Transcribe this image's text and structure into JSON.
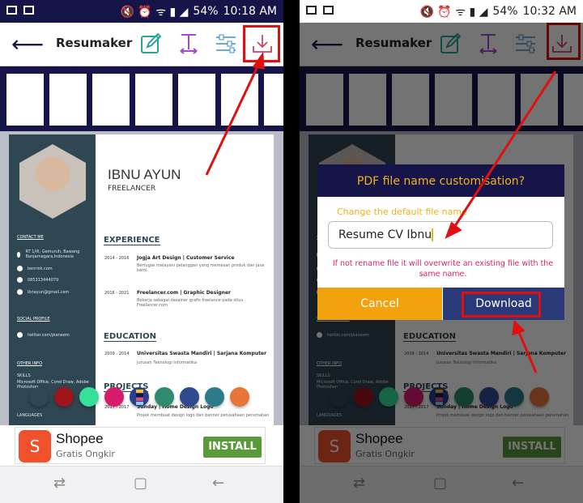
{
  "app": {
    "title": "Resumaker",
    "thumb_count": 7
  },
  "phones": [
    {
      "status": {
        "battery": "54%",
        "time": "10:18 AM"
      }
    },
    {
      "status": {
        "battery": "54%",
        "time": "10:32 AM"
      }
    }
  ],
  "toolbar": {
    "icons": [
      "back-arrow-icon",
      "edit-icon",
      "text-resize-icon",
      "sliders-icon",
      "download-icon"
    ]
  },
  "resume": {
    "name": "IBNU AYUN",
    "role": "FREELANCER",
    "contact_heading": "CONTACT ME",
    "contacts": [
      "RT 1/III, Gemuruh, Bawang Banjarnegara,Indonesia",
      "benrisk.com",
      "085313444079",
      "ibnayun@gmail.com"
    ],
    "social_heading": "SOCIAL PROFILE",
    "social": "twitter.com/pianeem",
    "other_heading": "OTHER INFO",
    "skills_label": "SKILLS",
    "skills": "Microsoft Office, Corel Draw, Adobe Photoshop",
    "languages_label": "LANGUAGES",
    "experience_heading": "EXPERIENCE",
    "experience": [
      {
        "years": "2014 - 2016",
        "title": "Jogja Art Design | Customer Service",
        "desc": "Bertugas melayani pelanggan yang memesan produk dan jasa kami."
      },
      {
        "years": "2016 - 2021",
        "title": "Freelancer.com | Graphic Designer",
        "desc": "Bekerja sebagai desainer grafis freelance pada situs Freelancer.com"
      }
    ],
    "education_heading": "EDUCATION",
    "education": [
      {
        "years": "2009 - 2014",
        "title": "Universitas Swasta Mandiri | Sarjana Komputer",
        "desc": "Jurusan Teknologi Informatika"
      }
    ],
    "projects_heading": "PROJECTS",
    "projects": [
      {
        "years": "2017 - 2017",
        "title": "Sunday | Home Design Logo",
        "desc": "Projek membuat design logo dan banner perusahaan perumahan"
      }
    ]
  },
  "swatches": [
    "#2f4653",
    "#a0141b",
    "#35e09a",
    "#d81b6a",
    "palette",
    "#2e8b6e",
    "#2f4b8f",
    "#2c7a8c",
    "#e8743a"
  ],
  "ad": {
    "title": "Shopee",
    "subtitle": "Gratis Ongkir",
    "install": "INSTALL",
    "logo": "S"
  },
  "dialog": {
    "title": "PDF file name customisation?",
    "label": "Change the default file name",
    "value": "Resume CV Ibnu",
    "warning": "If not rename file it will overwrite an existing file with the same name.",
    "cancel": "Cancel",
    "download": "Download"
  },
  "colors": {
    "navy": "#15154a",
    "accent": "#f2b11a",
    "highlight": "#e01010",
    "sidebar": "#2f4653"
  }
}
